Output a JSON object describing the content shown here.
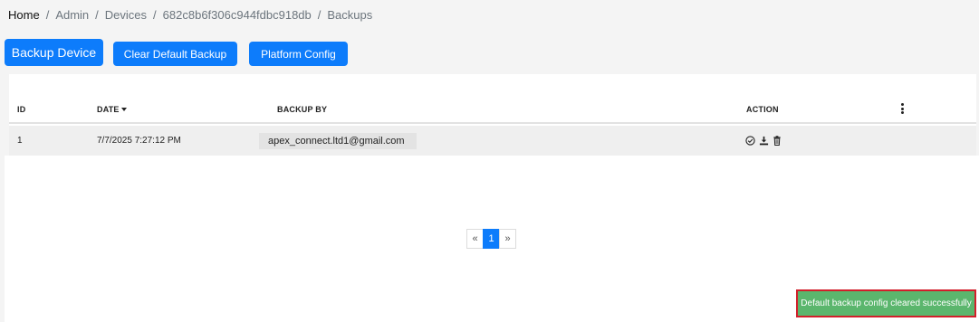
{
  "breadcrumb": {
    "items": [
      "Home",
      "Admin",
      "Devices",
      "682c8b6f306c944fdbc918db",
      "Backups"
    ],
    "separator": "/"
  },
  "toolbar": {
    "backup_device_label": "Backup Device",
    "clear_default_label": "Clear Default Backup",
    "platform_config_label": "Platform Config"
  },
  "table": {
    "columns": {
      "id": "ID",
      "date": "DATE",
      "backup_by": "BACKUP BY",
      "action": "ACTION"
    },
    "sort": {
      "column": "date",
      "direction": "descending"
    },
    "rows": [
      {
        "id": "1",
        "date": "7/7/2025 7:27:12 PM",
        "backup_by": "apex_connect.ltd1@gmail.com",
        "actions": [
          "check-circle-icon",
          "download-icon",
          "trash-icon"
        ]
      }
    ]
  },
  "pagination": {
    "prev": "«",
    "current": "1",
    "next": "»"
  },
  "toast": {
    "message": "Default backup config cleared successfully",
    "color": "#5bb66d"
  },
  "colors": {
    "primary": "#0d7cfb",
    "toast_border": "#d21f2b"
  }
}
